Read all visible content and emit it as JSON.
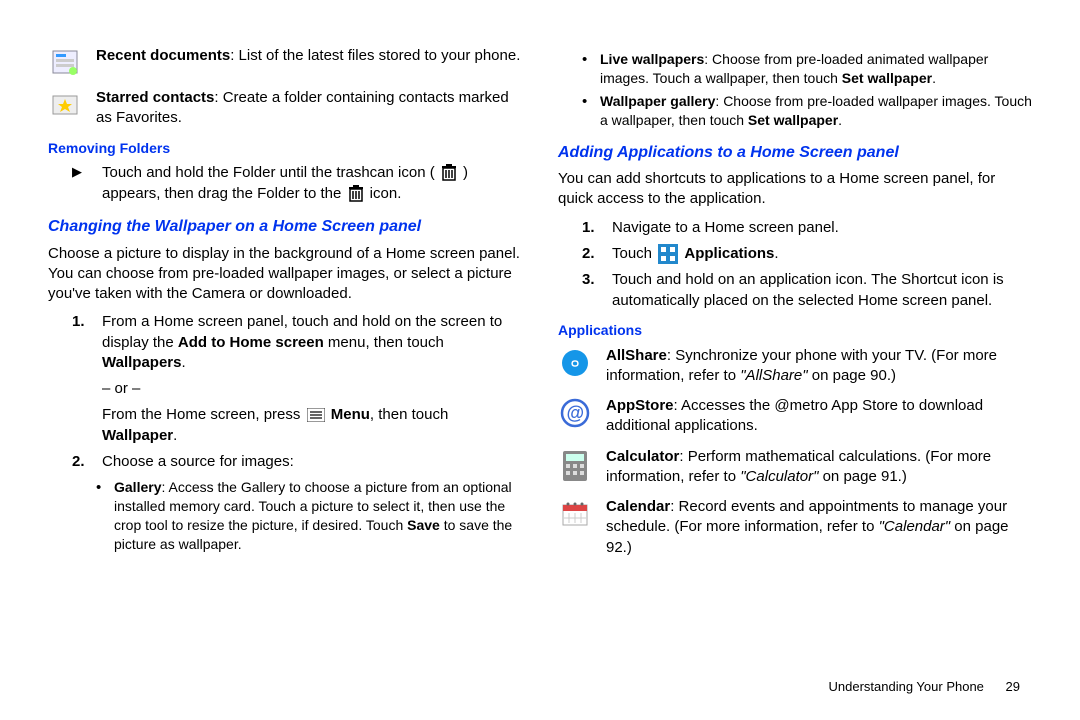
{
  "left": {
    "recent_bold": "Recent documents",
    "recent_text": ": List of the latest files stored to your phone.",
    "starred_bold": "Starred contacts",
    "starred_text": ": Create a folder containing contacts marked as Favorites.",
    "removing_heading": "Removing Folders",
    "removing_body_a": "Touch and hold the Folder until the trashcan icon (",
    "removing_body_b": ") appears, then drag the Folder to the ",
    "removing_body_c": " icon.",
    "wallpaper_heading": "Changing the Wallpaper on a Home Screen panel",
    "wallpaper_intro": "Choose a picture to display in the background of a Home screen panel. You can choose from pre-loaded wallpaper images, or select a picture you've taken with the Camera or downloaded.",
    "step1_a": "From a Home screen panel, touch and hold on the screen to display the ",
    "step1_bold": "Add to Home screen",
    "step1_b": " menu, then touch ",
    "step1_bold2": "Wallpapers",
    "step1_end": ".",
    "or_label": "– or –",
    "step1_alt_a": "From the Home screen, press ",
    "step1_alt_bold": "Menu",
    "step1_alt_b": ", then touch ",
    "step1_alt_bold2": "Wallpaper",
    "step1_alt_end": ".",
    "step2": "Choose a source for images:",
    "gallery_bold": "Gallery",
    "gallery_text": ": Access the Gallery to choose a picture from an optional installed memory card. Touch a picture to select it, then use the crop tool to resize the picture, if desired. Touch ",
    "gallery_bold2": "Save",
    "gallery_text2": " to save the picture as wallpaper."
  },
  "right": {
    "live_bold": "Live wallpapers",
    "live_text": ": Choose from pre-loaded animated wallpaper images. Touch a wallpaper, then touch ",
    "live_bold2": "Set wallpaper",
    "live_end": ".",
    "wg_bold": "Wallpaper gallery",
    "wg_text": ": Choose from pre-loaded wallpaper images. Touch a wallpaper, then touch ",
    "wg_bold2": "Set wallpaper",
    "wg_end": ".",
    "addapps_heading": "Adding Applications to a Home Screen panel",
    "addapps_intro": "You can add shortcuts to applications to a Home screen panel, for quick access to the application.",
    "aa_step1": "Navigate to a Home screen panel.",
    "aa_step2_a": "Touch ",
    "aa_step2_bold": "Applications",
    "aa_step2_end": ".",
    "aa_step3": "Touch and hold on an application icon. The Shortcut icon is automatically placed on the selected Home screen panel.",
    "apps_heading": "Applications",
    "allshare_bold": "AllShare",
    "allshare_text": ": Synchronize your phone with your TV. (For more information, refer to ",
    "allshare_ref": "\"AllShare\"",
    "allshare_text2": " on page 90.)",
    "appstore_bold": "AppStore",
    "appstore_text": ": Accesses the @metro App Store to download additional applications.",
    "calc_bold": "Calculator",
    "calc_text": ": Perform mathematical calculations. (For more information, refer to ",
    "calc_ref": "\"Calculator\"",
    "calc_text2": " on page 91.)",
    "cal_bold": "Calendar",
    "cal_text": ": Record events and appointments to manage your schedule. (For more information, refer to ",
    "cal_ref": "\"Calendar\"",
    "cal_text2": " on page 92.)"
  },
  "footer": {
    "section": "Understanding Your Phone",
    "page": "29"
  },
  "numbers": {
    "n1": "1.",
    "n2": "2.",
    "n3": "3."
  }
}
